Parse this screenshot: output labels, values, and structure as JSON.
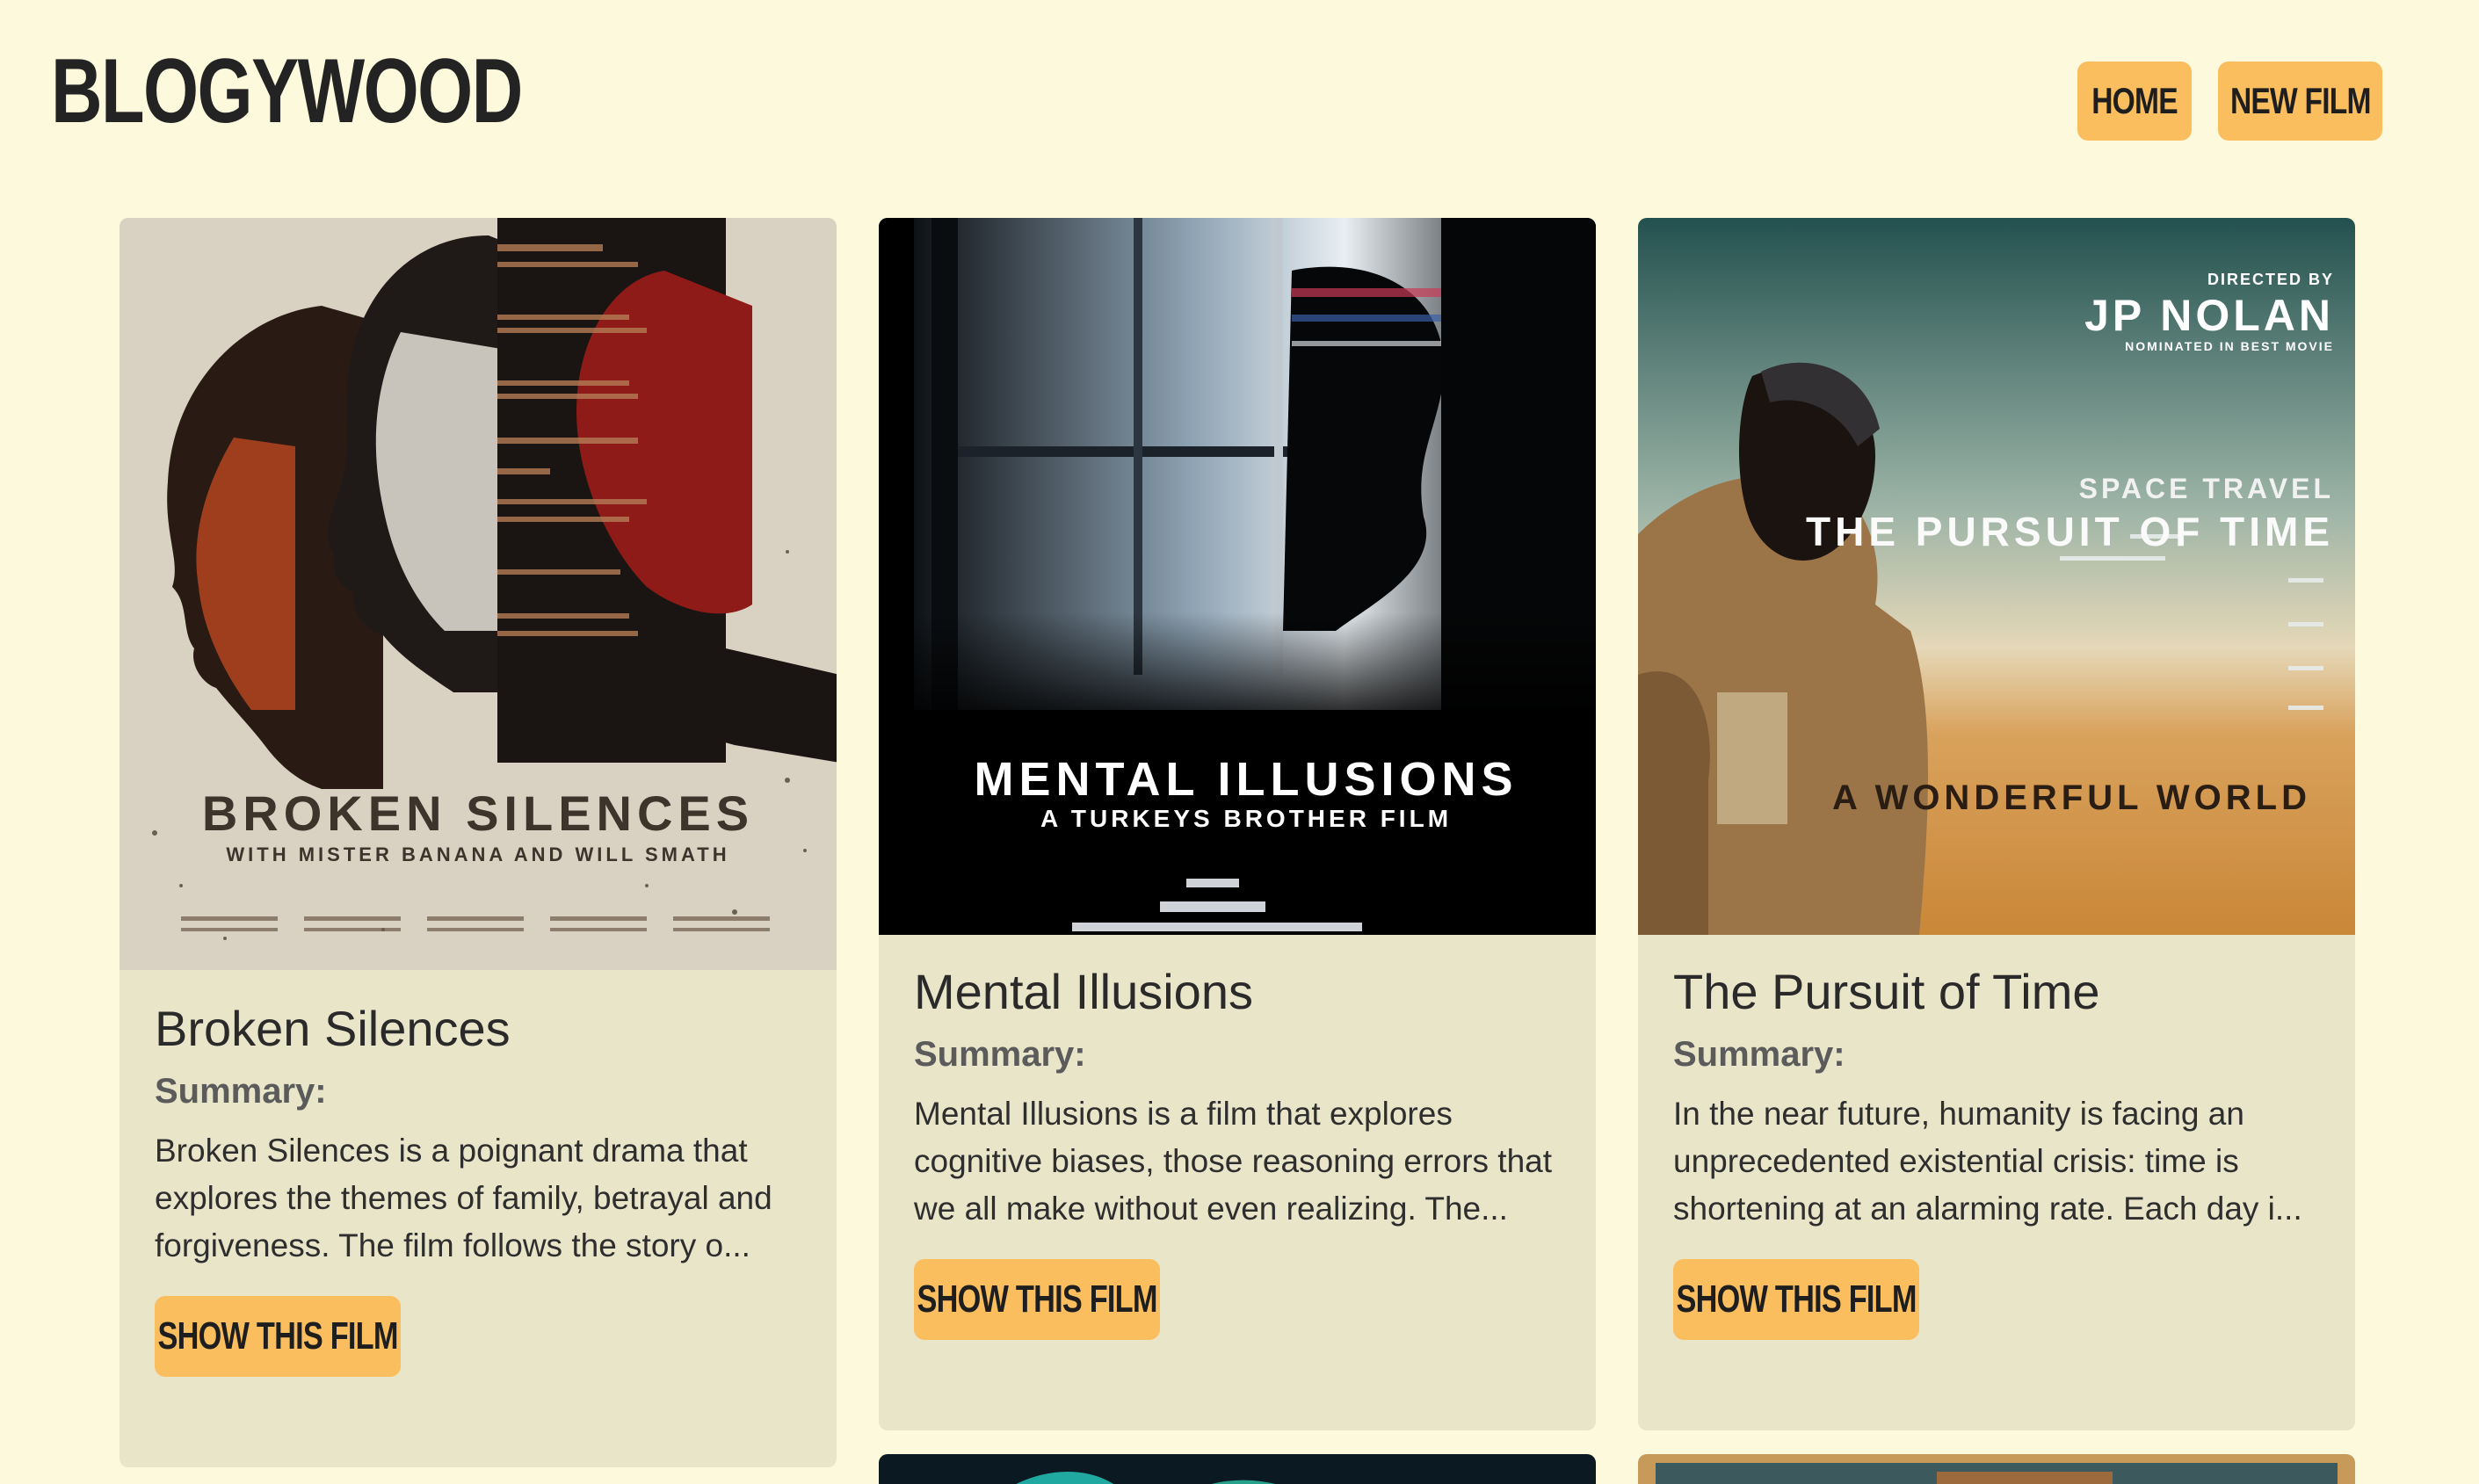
{
  "header": {
    "logo": "BLOGYWOOD",
    "nav": [
      {
        "label": "HOME"
      },
      {
        "label": "NEW FILM"
      }
    ]
  },
  "films": [
    {
      "title": "Broken Silences",
      "summary_label": "Summary:",
      "summary": "Broken Silences is a poignant drama that explores the themes of family, betrayal and forgiveness. The film follows the story o...",
      "button": "SHOW THIS FILM",
      "poster": {
        "title": "BROKEN SILENCES",
        "subtitle": "WITH MISTER BANANA AND WILL SMATH"
      }
    },
    {
      "title": "Mental Illusions",
      "summary_label": "Summary:",
      "summary": "Mental Illusions is a film that explores cognitive biases, those reasoning errors that we all make without even realizing. The...",
      "button": "SHOW THIS FILM",
      "poster": {
        "title": "MENTAL ILLUSIONS",
        "subtitle": "A TURKEYS BROTHER FILM"
      }
    },
    {
      "title": "The Pursuit of Time",
      "summary_label": "Summary:",
      "summary": "In the near future, humanity is facing an unprecedented existential crisis: time is shortening at an alarming rate. Each day i...",
      "button": "SHOW THIS FILM",
      "poster": {
        "directed_by": "DIRECTED BY",
        "director": "JP NOLAN",
        "nominated": "NOMINATED IN BEST MOVIE",
        "tagline": "SPACE TRAVEL",
        "title": "THE PURSUIT OF TIME",
        "bottom": "A WONDERFUL WORLD"
      }
    }
  ],
  "colors": {
    "background": "#fdf9dc",
    "card": "#e8e5c9",
    "button": "#fbbe5e",
    "text": "#232323"
  }
}
